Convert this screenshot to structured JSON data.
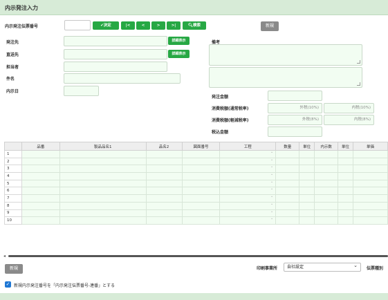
{
  "header": {
    "title": "内示発注入力"
  },
  "form": {
    "slip_no_label": "内示発注伝票番号",
    "slip_no_value": "",
    "buttons": {
      "confirm": "決定",
      "first": "|<",
      "prev": "<",
      "next": ">",
      "last": ">|",
      "search": "検索"
    },
    "new_button": "新規",
    "order_to_label": "発注先",
    "deliver_to_label": "直送先",
    "person_label": "担当者",
    "subject_label": "件名",
    "date_label": "内示日",
    "detail_btn_1": "詳細表示",
    "detail_btn_2": "詳細表示",
    "remarks_label": "備考",
    "order_amount_label": "発注金額",
    "tax_std_label": "消費税額(通常税率)",
    "tax_red_label": "消費税額(軽減税率)",
    "tax_incl_label": "税込金額",
    "tax_std_ext": "外税(10%)",
    "tax_std_int": "内税(10%)",
    "tax_red_ext": "外税(8%)",
    "tax_red_int": "内税(8%)"
  },
  "grid": {
    "columns": [
      "",
      "品番",
      "製品品名1",
      "品名2",
      "図面番号",
      "工程",
      "数量",
      "単位",
      "内示数",
      "単位",
      "単価"
    ],
    "rows": [
      "1",
      "2",
      "3",
      "4",
      "5",
      "6",
      "7",
      "8",
      "9",
      "10"
    ]
  },
  "bottom": {
    "new_button": "新規",
    "print_office_label": "印刷事業所",
    "print_office_value": "自社設定",
    "slip_type_label": "伝票種別",
    "checkbox_label": "新規内示発注番号を「内示発注伝票番号-連番」とする",
    "checkbox_checked": true
  },
  "colors": {
    "accent": "#27a844",
    "header_bg": "#d7ebd7",
    "input_bg": "#f2fdf2"
  }
}
